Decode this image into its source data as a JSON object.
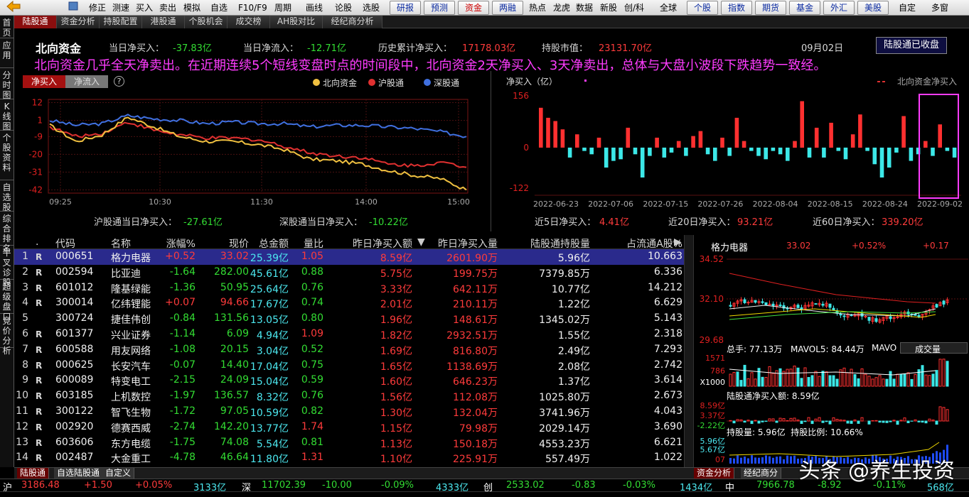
{
  "toolbar": {
    "items": [
      "修正",
      "测速",
      "买入",
      "卖出",
      "模拟",
      "自选",
      "F10/F9",
      "周期",
      "画线",
      "论股",
      "选股"
    ],
    "navs": [
      "研报",
      "预测",
      "资金",
      "两融"
    ],
    "items2": [
      "热点",
      "龙虎",
      "数据",
      "新股",
      "创/科",
      "全球"
    ],
    "navs2": [
      "个股",
      "指数",
      "期货",
      "基金",
      "外汇",
      "美股"
    ],
    "items3": [
      "自定",
      "多窗"
    ]
  },
  "tabs": [
    "陆股通",
    "资金分析",
    "持股配置",
    "港股通",
    "个股机会",
    "成交榜",
    "AH股对比",
    "经纪商分析"
  ],
  "sidebar": [
    "首页",
    "应用",
    "分时图",
    "K线图",
    "个股资料",
    "自选股",
    "综合排名",
    "牛叉诊股",
    "超级盘口",
    "竞价分析"
  ],
  "header": {
    "title": "北向资金",
    "today_net_buy_label": "当日净买入：",
    "today_net_buy": "-37.83亿",
    "today_net_inflow_label": "当日净流入：",
    "today_net_inflow": "-12.71亿",
    "history_label": "历史累计净买入：",
    "history_value": "17178.03亿",
    "holdings_label": "持股市值：",
    "holdings_value": "23131.70亿",
    "date": "09月02日",
    "status_button": "陆股通已收盘",
    "commentary": "北向资金几乎全天净卖出。在近期连续5个短线变盘时点的时间段中，北向资金2天净买入、3天净卖出，总体与大盘小波段下跌趋势一致经。"
  },
  "intraday": {
    "btn_buy": "净买入",
    "btn_flow": "净流入",
    "help": "?",
    "legend": [
      {
        "name": "北向资金",
        "color": "#f0c040"
      },
      {
        "name": "沪股通",
        "color": "#e03030"
      },
      {
        "name": "深股通",
        "color": "#4070e0"
      }
    ],
    "yticks": [
      12,
      1,
      -9,
      -20,
      -31,
      -42
    ],
    "xticks": [
      "09:25",
      "10:30",
      "11:30",
      "14:00",
      "15:00"
    ],
    "sh_label": "沪股通当日净买入：",
    "sh_value": "-27.61亿",
    "sz_label": "深股通当日净买入：",
    "sz_value": "-10.22亿"
  },
  "chart_data": [
    {
      "type": "line",
      "title": "",
      "ylim": [
        -44,
        14
      ],
      "x_times": [
        "09:25",
        "09:45",
        "10:00",
        "10:15",
        "10:30",
        "10:45",
        "11:00",
        "11:15",
        "11:30",
        "13:15",
        "13:30",
        "13:45",
        "14:00",
        "14:15",
        "14:30",
        "14:45",
        "15:00"
      ],
      "series": [
        {
          "name": "北向资金",
          "color": "#f0c040",
          "values": [
            -2,
            -12,
            -8,
            3,
            -3,
            -9,
            -12,
            -12,
            -14,
            -17,
            -23,
            -24,
            -26,
            -30,
            -33,
            -35,
            -42
          ]
        },
        {
          "name": "沪股通",
          "color": "#e03030",
          "values": [
            -3,
            -9,
            -7,
            0,
            -5,
            -8,
            -10,
            -10,
            -11,
            -15,
            -19,
            -21,
            -22,
            -26,
            -27,
            -25,
            -28
          ]
        },
        {
          "name": "深股通",
          "color": "#4070e0",
          "values": [
            1,
            -2,
            -1,
            4,
            2,
            1,
            -1,
            0,
            -1,
            -1,
            -3,
            -2,
            -2,
            -3,
            -4,
            -6,
            -9
          ]
        }
      ]
    },
    {
      "type": "bar",
      "title": "",
      "ylabel": "净买入（亿）",
      "legend": "北向资金净买入",
      "ylim": [
        -122,
        156
      ],
      "yticks": [
        156,
        0,
        -122
      ],
      "xtick_labels": [
        "2022-06-23",
        "2022-07-06",
        "2022-07-15",
        "2022-07-26",
        "2022-08-04",
        "2022-08-15",
        "2022-08-24",
        "2022-09-02"
      ],
      "values": [
        120,
        90,
        80,
        55,
        -30,
        40,
        -10,
        -20,
        30,
        -60,
        -40,
        -35,
        60,
        -20,
        -90,
        -25,
        30,
        -30,
        -15,
        20,
        -25,
        35,
        50,
        -20,
        -40,
        30,
        -25,
        90,
        20,
        -10,
        -25,
        -35,
        -10,
        -20,
        -40,
        20,
        140,
        -30,
        60,
        -30,
        75,
        -10,
        -35,
        40,
        100,
        -10,
        -50,
        -90,
        -60,
        -15,
        95,
        -40,
        -20,
        20,
        -25,
        70,
        -10,
        -30
      ],
      "highlight_last": 5
    }
  ],
  "bar_footer": {
    "d5_label": "近5日净买入：",
    "d5_value": "4.41亿",
    "d20_label": "近20日净买入：",
    "d20_value": "93.21亿",
    "d60_label": "近60日净买入：",
    "d60_value": "339.20亿"
  },
  "table": {
    "headers": [
      ".",
      "代码",
      "名称",
      "涨幅%",
      "现价",
      "总金额",
      "量比",
      "昨日净买入额",
      "昨日净买入量",
      "陆股通持股量",
      "占流通A股%"
    ],
    "rows": [
      {
        "n": "1",
        "flag": "R",
        "code": "000651",
        "name": "格力电器",
        "chg": "+0.52",
        "price": "33.02",
        "amt": "25.39亿",
        "vr": "1.05",
        "nb_amt": "8.59亿",
        "nb_vol": "2601.90万",
        "hold": "5.96亿",
        "pct": "10.663"
      },
      {
        "n": "2",
        "flag": "R",
        "code": "002594",
        "name": "比亚迪",
        "chg": "-1.64",
        "price": "282.00",
        "amt": "45.61亿",
        "vr": "0.88",
        "nb_amt": "5.75亿",
        "nb_vol": "199.75万",
        "hold": "7379.85万",
        "pct": "6.336"
      },
      {
        "n": "3",
        "flag": "R",
        "code": "601012",
        "name": "隆基绿能",
        "chg": "-1.36",
        "price": "50.95",
        "amt": "25.64亿",
        "vr": "0.76",
        "nb_amt": "3.33亿",
        "nb_vol": "642.11万",
        "hold": "10.77亿",
        "pct": "14.212"
      },
      {
        "n": "4",
        "flag": "R",
        "code": "300014",
        "name": "亿纬锂能",
        "chg": "+0.07",
        "price": "94.66",
        "amt": "17.67亿",
        "vr": "0.74",
        "nb_amt": "2.01亿",
        "nb_vol": "210.11万",
        "hold": "1.22亿",
        "pct": "6.629"
      },
      {
        "n": "5",
        "flag": "",
        "code": "300724",
        "name": "捷佳伟创",
        "chg": "-0.84",
        "price": "131.56",
        "amt": "13.05亿",
        "vr": "0.80",
        "nb_amt": "1.96亿",
        "nb_vol": "148.61万",
        "hold": "1345.02万",
        "pct": "5.143"
      },
      {
        "n": "6",
        "flag": "R",
        "code": "601377",
        "name": "兴业证券",
        "chg": "-1.14",
        "price": "6.09",
        "amt": "4.94亿",
        "vr": "1.09",
        "nb_amt": "1.82亿",
        "nb_vol": "2932.51万",
        "hold": "1.55亿",
        "pct": "2.318"
      },
      {
        "n": "7",
        "flag": "R",
        "code": "600588",
        "name": "用友网络",
        "chg": "-1.08",
        "price": "20.15",
        "amt": "3.04亿",
        "vr": "0.52",
        "nb_amt": "1.69亿",
        "nb_vol": "816.80万",
        "hold": "2.49亿",
        "pct": "7.293"
      },
      {
        "n": "8",
        "flag": "R",
        "code": "000625",
        "name": "长安汽车",
        "chg": "-0.07",
        "price": "14.40",
        "amt": "17.04亿",
        "vr": "0.75",
        "nb_amt": "1.65亿",
        "nb_vol": "1138.69万",
        "hold": "2.08亿",
        "pct": "2.742"
      },
      {
        "n": "9",
        "flag": "R",
        "code": "600089",
        "name": "特变电工",
        "chg": "-2.15",
        "price": "24.09",
        "amt": "15.04亿",
        "vr": "0.59",
        "nb_amt": "1.60亿",
        "nb_vol": "646.23万",
        "hold": "1.37亿",
        "pct": "3.614"
      },
      {
        "n": "10",
        "flag": "R",
        "code": "603185",
        "name": "上机数控",
        "chg": "-1.97",
        "price": "136.57",
        "amt": "8.32亿",
        "vr": "0.76",
        "nb_amt": "1.56亿",
        "nb_vol": "112.08万",
        "hold": "1025.80万",
        "pct": "2.673"
      },
      {
        "n": "11",
        "flag": "R",
        "code": "300122",
        "name": "智飞生物",
        "chg": "-1.72",
        "price": "97.05",
        "amt": "10.59亿",
        "vr": "0.82",
        "nb_amt": "1.30亿",
        "nb_vol": "132.04万",
        "hold": "3741.96万",
        "pct": "4.043"
      },
      {
        "n": "12",
        "flag": "R",
        "code": "002920",
        "name": "德赛西威",
        "chg": "-2.74",
        "price": "142.20",
        "amt": "13.77亿",
        "vr": "1.74",
        "nb_amt": "1.15亿",
        "nb_vol": "79.98万",
        "hold": "2029.14万",
        "pct": "3.690"
      },
      {
        "n": "13",
        "flag": "R",
        "code": "603606",
        "name": "东方电缆",
        "chg": "-1.75",
        "price": "74.08",
        "amt": "5.54亿",
        "vr": "0.81",
        "nb_amt": "1.13亿",
        "nb_vol": "150.18万",
        "hold": "4553.23万",
        "pct": "6.621"
      },
      {
        "n": "14",
        "flag": "R",
        "code": "002487",
        "name": "大金重工",
        "chg": "-4.78",
        "price": "46.64",
        "amt": "11.80亿",
        "vr": "1.31",
        "nb_amt": "1.10亿",
        "nb_vol": "225.91万",
        "hold": "557.49万",
        "pct": "1.022"
      }
    ]
  },
  "stock": {
    "name": "格力电器",
    "price": "33.02",
    "chg_pct": "+0.52%",
    "chg": "+0.17",
    "p_high": "34.52",
    "p_mid": "32.10",
    "p_low": "29.68",
    "vol_label": "总手: 77.13万",
    "mavol5": "MAVOL5: 84.44万",
    "mavo": "MAVO",
    "vol_select": "成交量",
    "v1": "1571",
    "v2": "786",
    "vunit": "X1000",
    "nb_label": "陆股通净买入额: 8.59亿",
    "nb1": "8.59亿",
    "nb2": "3.37亿",
    "nb3": "-2.22亿",
    "hold_label": "持股量: 5.96亿",
    "hold_ratio": "持股比例: 10.66%",
    "h1": "5.96亿",
    "h2": "5.67亿",
    "h3": "07"
  },
  "bottom_tabs": [
    "陆股通",
    "自选陆股通",
    "自定义"
  ],
  "right_bottom_tabs": [
    "资金分析",
    "经纪商分"
  ],
  "status": {
    "sh": "沪",
    "sh_idx": "3186.48",
    "sh_chg": "+1.50",
    "sh_pct": "+0.05%",
    "sh_amt": "3133亿",
    "sz": "深",
    "sz_idx": "11702.39",
    "sz_chg": "-10.00",
    "sz_pct": "-0.09%",
    "sz_amt": "4333亿",
    "cy": "创",
    "cy_idx": "2533.02",
    "cy_chg": "-0.83",
    "cy_pct": "-0.03%",
    "cy_amt": "1434亿",
    "zh": "中",
    "zh_idx": "7966.78",
    "zh_chg": "-8.92",
    "zh_pct": "-0.11%",
    "zh_amt": "568亿"
  },
  "watermark": "头条 @养生投资"
}
